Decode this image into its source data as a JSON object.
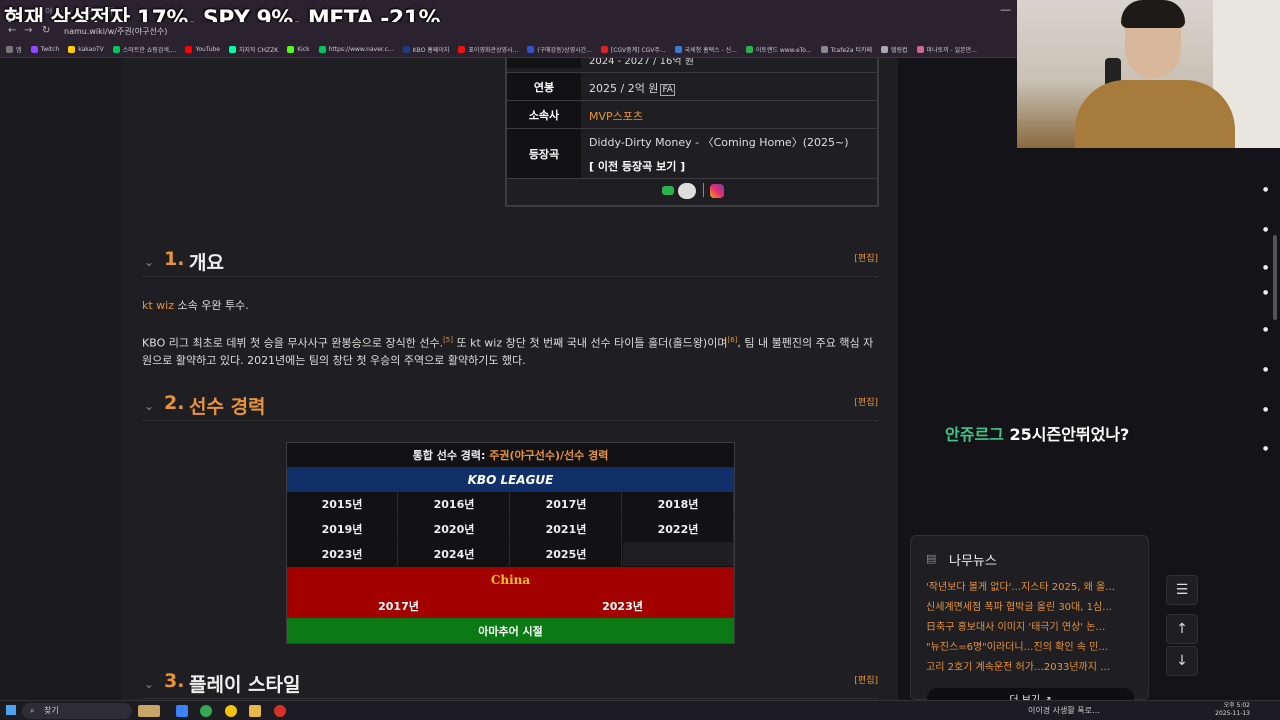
{
  "stream_overlay": {
    "title": "현재 삼성전자 17%, SPY 9%, META -21%"
  },
  "browser": {
    "tab_fragment": "· · · 야 · · · · · · 구 · 나무",
    "url": "namu.wiki/w/주권(야구선수)",
    "window_controls": [
      "—",
      "□",
      "✕"
    ],
    "bookmarks": [
      {
        "label": "앱",
        "color": "#777"
      },
      {
        "label": "Twitch",
        "color": "#9146ff"
      },
      {
        "label": "kakaoTV",
        "color": "#ffcd00"
      },
      {
        "label": "스마트한 쇼핑검색,...",
        "color": "#03c75a"
      },
      {
        "label": "YouTube",
        "color": "#ff0000"
      },
      {
        "label": "치지직 CHZZK",
        "color": "#00ffa3"
      },
      {
        "label": "Kick",
        "color": "#53fc18"
      },
      {
        "label": "https://www.naver.c...",
        "color": "#03c75a"
      },
      {
        "label": "KBO 홈페이지",
        "color": "#1b3c87"
      },
      {
        "label": "표이영화관상영시...",
        "color": "#e11"
      },
      {
        "label": "(구매강동)상영시간...",
        "color": "#3355cc"
      },
      {
        "label": "[CGV중계] CGV주...",
        "color": "#d22"
      },
      {
        "label": "국세청 홈택스 - 신...",
        "color": "#3a7bd5"
      },
      {
        "label": "이토랜드 www.eTo...",
        "color": "#2bb24c"
      },
      {
        "label": "Tcafe2a 티카페",
        "color": "#888"
      },
      {
        "label": "텔링컵",
        "color": "#aaa"
      },
      {
        "label": "마나토끼 - 일본만...",
        "color": "#cc6699"
      }
    ]
  },
  "infobox": {
    "contract_fragment": "2024 - 2027 / 16억 원",
    "rows": [
      {
        "head": "연봉",
        "value": "2025 / 2억 원",
        "badge": "FA"
      },
      {
        "head": "소속사",
        "value": "MVP스포츠"
      },
      {
        "head": "등장곡",
        "value": "Diddy-Dirty Money - 〈Coming Home〉(2025~)",
        "link": "[ 이전 등장곡 보기 ]"
      }
    ]
  },
  "sections": [
    {
      "num": "1.",
      "title": "개요",
      "edit": "[편집]"
    },
    {
      "num": "2.",
      "title": "선수 경력",
      "edit": "[편집]"
    },
    {
      "num": "3.",
      "title": "플레이 스타일",
      "edit": "[편집]"
    }
  ],
  "overview": {
    "line1_link": "kt wiz",
    "line1_rest": " 소속 우완 투수.",
    "para2_a": "KBO 리그 최초로 데뷔 첫 승을 무사사구 완봉승으로 장식한 선수.",
    "sup1": "[5]",
    "para2_b": " 또 kt wiz 창단 첫 번째 국내 선수 타이틀 홀더(홀드왕)이며",
    "sup2": "[6]",
    "para2_c": ", 팀 내 불펜진의 주요 핵심 자",
    "para2_d": "원으로 활약하고 있다. 2021년에는 팀의 창단 첫 우승의 주역으로 활약하기도 했다."
  },
  "career": {
    "title_prefix": "통합 선수 경력: ",
    "title_link": "주권(야구선수)/선수 경력",
    "kbo_label": "KBO LEAGUE",
    "kbo_years": [
      [
        "2015년",
        "2016년",
        "2017년",
        "2018년"
      ],
      [
        "2019년",
        "2020년",
        "2021년",
        "2022년"
      ],
      [
        "2023년",
        "2024년",
        "2025년",
        ""
      ]
    ],
    "china_label": "China",
    "china_years": [
      "2017년",
      "2023년"
    ],
    "amateur_label": "아마추어 시절"
  },
  "sidebar": {
    "promo_green": "안쥬르그",
    "promo_white": " 25시즌안뛰었나?",
    "news_title": "나무뉴스",
    "news_items": [
      "'작년보다 볼게 없다'...지스타 2025, 왜 올…",
      "신세계면세점 폭파 협박글 올린 30대, 1심…",
      "日축구 홍보대사 이미지 '태극기 연상' 논…",
      "\"뉴진스=6명\"이라더니…진의 확인 속 민…",
      "고리 2호기 계속운전 허가…2033년까지 …"
    ],
    "more_label": "더 보기 ↗",
    "toc_icon": "list-icon",
    "up_icon": "arrow-up-icon",
    "down_icon": "arrow-down-icon"
  },
  "taskbar": {
    "search_placeholder": "찾기",
    "tray_text": "이이경 사생활 폭로…",
    "time": "오후 5:02",
    "date": "2025-11-13"
  }
}
